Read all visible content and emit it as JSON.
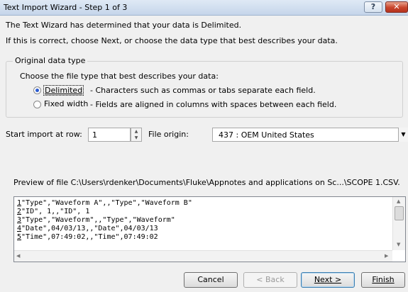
{
  "window": {
    "title": "Text Import Wizard - Step 1 of 3",
    "help_label": "?",
    "close_label": "✕"
  },
  "intro": {
    "line1": "The Text Wizard has determined that your data is Delimited.",
    "line2": "If this is correct, choose Next, or choose the data type that best describes your data."
  },
  "original_data_type": {
    "legend": "Original data type",
    "prompt": "Choose the file type that best describes your data:",
    "options": [
      {
        "label": "Delimited",
        "desc": "- Characters such as commas or tabs separate each field.",
        "selected": true
      },
      {
        "label": "Fixed width",
        "desc": "- Fields are aligned in columns with spaces between each field.",
        "selected": false
      }
    ]
  },
  "start_import": {
    "label": "Start import at row:",
    "value": "1"
  },
  "file_origin": {
    "label": "File origin:",
    "value": "437 : OEM United States"
  },
  "preview": {
    "label": "Preview of file C:\\Users\\rdenker\\Documents\\Fluke\\Appnotes and applications on Sc...\\SCOPE 1.CSV.",
    "rows": [
      {
        "num": "1",
        "text": "\"Type\",\"Waveform A\",,\"Type\",\"Waveform B\""
      },
      {
        "num": "2",
        "text": "\"ID\", 1,,\"ID\", 1"
      },
      {
        "num": "3",
        "text": "\"Type\",\"Waveform\",,\"Type\",\"Waveform\""
      },
      {
        "num": "4",
        "text": "\"Date\",04/03/13,,\"Date\",04/03/13"
      },
      {
        "num": "5",
        "text": "\"Time\",07:49:02,,\"Time\",07:49:02"
      }
    ]
  },
  "buttons": {
    "cancel": "Cancel",
    "back": "< Back",
    "next": "Next >",
    "finish": "Finish"
  }
}
